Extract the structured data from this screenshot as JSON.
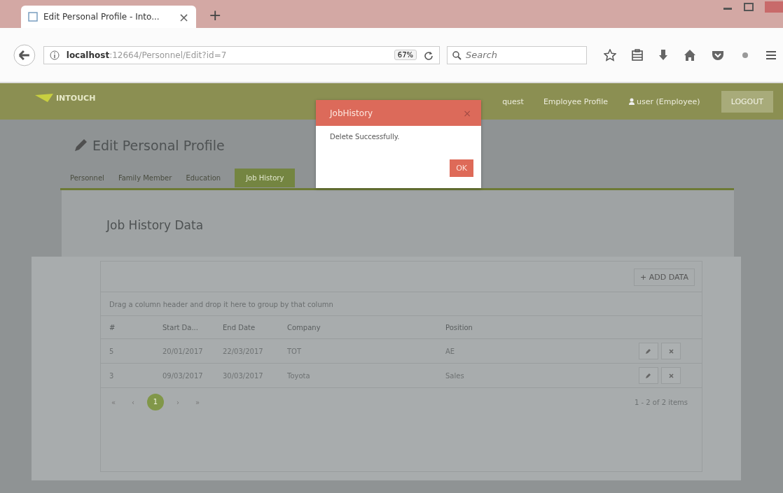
{
  "browser": {
    "tab": {
      "title": "Edit Personal Profile - Into...",
      "close": "×"
    },
    "new_tab": "+",
    "url": {
      "host": "localhost",
      "path": ":12664/Personnel/Edit?id=7"
    },
    "zoom": "67%",
    "search": {
      "placeholder": "Search"
    }
  },
  "navbar": {
    "brand": "INTOUCH",
    "items": [
      "quest",
      "Employee Profile"
    ],
    "user": "user (Employee)",
    "logout": "LOGOUT"
  },
  "page": {
    "title": "Edit Personal Profile",
    "tabs": [
      {
        "label": "Personnel",
        "selected": false
      },
      {
        "label": "Family Member",
        "selected": false
      },
      {
        "label": "Education",
        "selected": false
      },
      {
        "label": "Job History",
        "selected": true
      }
    ],
    "section_title": "Job History Data",
    "add_button": "+ ADD DATA",
    "grid": {
      "group_hint": "Drag a column header and drop it here to group by that column",
      "columns": [
        "#",
        "Start Da...",
        "End Date",
        "Company",
        "Position"
      ],
      "rows": [
        {
          "cells": [
            "5",
            "20/01/2017",
            "22/03/2017",
            "TOT",
            "AE"
          ]
        },
        {
          "cells": [
            "3",
            "09/03/2017",
            "30/03/2017",
            "Toyota",
            "Sales"
          ]
        }
      ],
      "pager": [
        {
          "label": "«",
          "selected": false
        },
        {
          "label": "‹",
          "selected": false
        },
        {
          "label": "1",
          "selected": true
        },
        {
          "label": "›",
          "selected": false
        },
        {
          "label": "»",
          "selected": false
        }
      ],
      "summary": "1 - 2 of 2 items"
    }
  },
  "dialog": {
    "title": "JobHistory",
    "close": "×",
    "message": "Delete Successfully.",
    "ok": "OK"
  }
}
